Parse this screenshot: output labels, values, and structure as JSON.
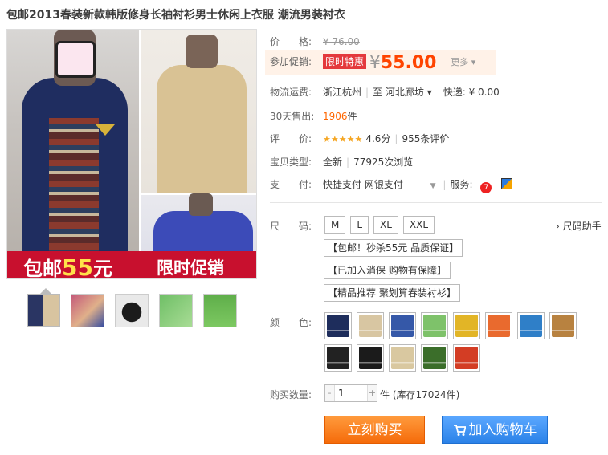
{
  "title": "包邮2013春装新款韩版修身长袖衬衫男士休闲上衣服 潮流男装衬衣",
  "banner": {
    "prefix": "包邮",
    "number": "55",
    "suffix": "元",
    "right": "限时促销"
  },
  "price": {
    "label": "价　　格:",
    "value": "¥ 76.00"
  },
  "promo": {
    "label": "参加促销:",
    "tag": "限时特惠",
    "yen": "¥",
    "value": "55.00",
    "more": "更多 ▾"
  },
  "shipping": {
    "label": "物流运费:",
    "from": "浙江杭州",
    "to": "至  河北廊坊 ▾",
    "express": "快递: ¥ 0.00"
  },
  "sales": {
    "label": "30天售出:",
    "count": "1906",
    "unit": "件"
  },
  "rating": {
    "label": "评　　价:",
    "stars": "★★★★★",
    "score": "4.6分",
    "reviews": "955条评价"
  },
  "item": {
    "label": "宝贝类型:",
    "type": "全新",
    "views": "77925次浏览"
  },
  "pay": {
    "label": "支　　付:",
    "methods": "快捷支付  网银支付",
    "service": "服务:"
  },
  "size": {
    "label": "尺　　码:",
    "options": [
      "M",
      "L",
      "XL",
      "XXL"
    ],
    "helper": "› 尺码助手"
  },
  "promo_tags": [
    "【包邮！秒杀55元 品质保证】",
    "【已加入消保 购物有保障】",
    "【精品推荐 聚划算春装衬衫】"
  ],
  "color": {
    "label": "颜　　色:",
    "swatches": [
      "#1e2d5c",
      "#d8c6a2",
      "#3558a8",
      "#7ec26a",
      "#e2b526",
      "#e96a2e",
      "#2f7fc8",
      "#b88240",
      "#222222",
      "#1b1b1b",
      "#d9c8a0",
      "#3b6e2a",
      "#d33d24"
    ]
  },
  "quantity": {
    "label": "购买数量:",
    "value": "1",
    "minus": "-",
    "plus": "+",
    "stock": "件 (库存17024件)"
  },
  "buttons": {
    "buy": "立刻购买",
    "cart": "加入购物车"
  }
}
